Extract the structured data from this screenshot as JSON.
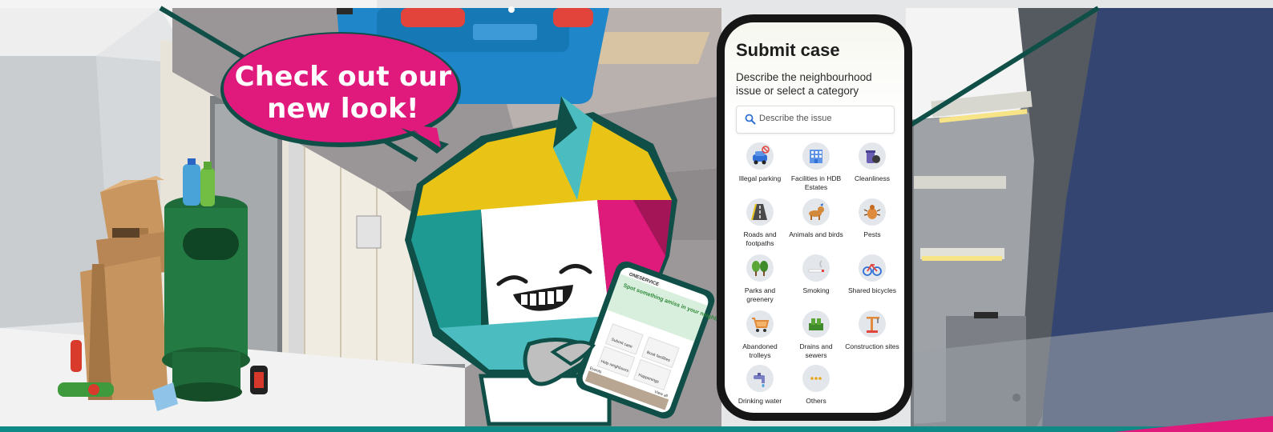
{
  "banner": {
    "speech_bubble_line1": "Check out our",
    "speech_bubble_line2": "new look!"
  },
  "phone": {
    "title": "Submit case",
    "subtitle": "Describe the neighbourhood issue or select a category",
    "search": {
      "placeholder": "Describe the issue",
      "icon": "search-icon"
    },
    "categories": [
      {
        "label": "Illegal parking",
        "icon": "car-icon"
      },
      {
        "label": "Facilities in HDB Estates",
        "icon": "building-icon"
      },
      {
        "label": "Cleanliness",
        "icon": "trash-bag-icon"
      },
      {
        "label": "Roads and footpaths",
        "icon": "road-icon"
      },
      {
        "label": "Animals and birds",
        "icon": "dog-icon"
      },
      {
        "label": "Pests",
        "icon": "bug-icon"
      },
      {
        "label": "Parks and greenery",
        "icon": "trees-icon"
      },
      {
        "label": "Smoking",
        "icon": "smoking-icon"
      },
      {
        "label": "Shared bicycles",
        "icon": "bicycle-icon"
      },
      {
        "label": "Abandoned trolleys",
        "icon": "trolley-icon"
      },
      {
        "label": "Drains and sewers",
        "icon": "drain-icon"
      },
      {
        "label": "Construction sites",
        "icon": "crane-icon"
      },
      {
        "label": "Drinking water",
        "icon": "tap-icon"
      },
      {
        "label": "Others",
        "icon": "more-icon"
      }
    ]
  },
  "small_phone": {
    "brand": "ONESERVICE",
    "headline": "Spot something amiss in your neighbourhood?",
    "actions": [
      "Submit case",
      "Book facilities",
      "Help neighbours",
      "Happenings"
    ],
    "section": "Events",
    "view_all": "View all"
  },
  "colors": {
    "bubble": "#e0197d",
    "mascot_teal": "#1f9a93",
    "mascot_yellow": "#e9c416",
    "mascot_magenta": "#de1a7b",
    "mascot_outline": "#0f4f48",
    "wall_navy": "#3a4a7a"
  }
}
